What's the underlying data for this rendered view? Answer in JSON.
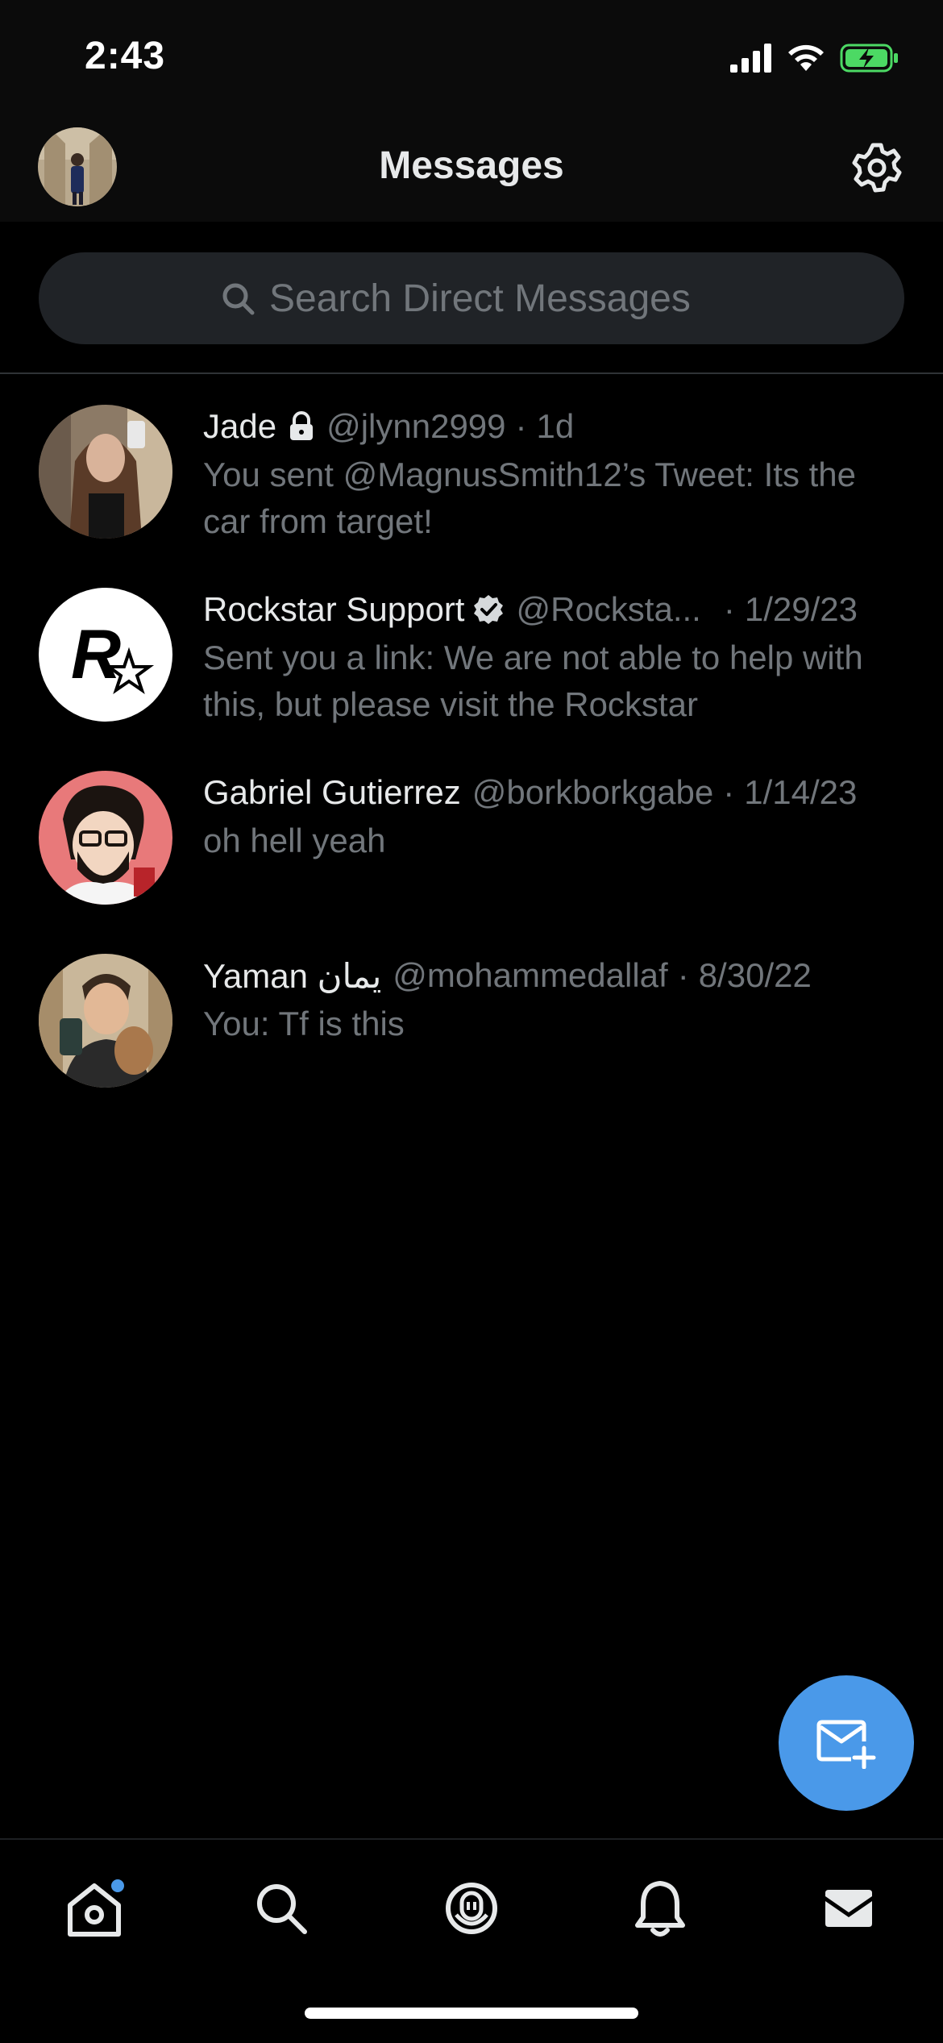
{
  "status_bar": {
    "time": "2:43"
  },
  "header": {
    "title": "Messages"
  },
  "search": {
    "placeholder": "Search Direct Messages"
  },
  "conversations": [
    {
      "name": "Jade",
      "handle": "@jlynn2999",
      "separator": "·",
      "time": "1d",
      "preview": "You sent @MagnusSmith12’s Tweet: Its the car from target!"
    },
    {
      "name": "Rockstar Support",
      "handle": "@Rocksta...",
      "separator": "·",
      "time": "1/29/23",
      "preview": "Sent you a link: We are not able to help with this, but please visit the Rockstar"
    },
    {
      "name": "Gabriel Gutierrez",
      "handle": "@borkborkgabe",
      "separator": "·",
      "time": "1/14/23",
      "preview": "oh hell yeah"
    },
    {
      "name": "Yaman يمان",
      "handle": "@mohammedallaf",
      "separator": "·",
      "time": "8/30/22",
      "preview": "You: Tf is this"
    }
  ],
  "icons": {
    "settings": "gear-icon",
    "search": "search-icon",
    "lock": "lock-icon",
    "verified": "verified-badge-icon",
    "new_message": "new-message-icon",
    "tabs": [
      "home-icon",
      "search-icon",
      "spaces-icon",
      "bell-icon",
      "mail-icon"
    ]
  },
  "colors": {
    "accent": "#4a99e9",
    "background": "#000000",
    "secondary_text": "#71767b",
    "battery": "#4cd964"
  }
}
